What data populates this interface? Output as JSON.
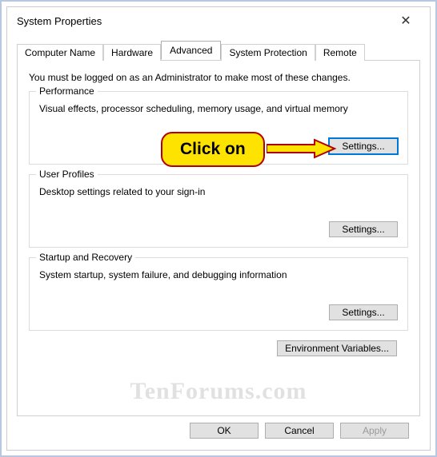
{
  "window": {
    "title": "System Properties"
  },
  "tabs": {
    "computer_name": "Computer Name",
    "hardware": "Hardware",
    "advanced": "Advanced",
    "system_protection": "System Protection",
    "remote": "Remote"
  },
  "advanced": {
    "admin_note": "You must be logged on as an Administrator to make most of these changes.",
    "performance": {
      "title": "Performance",
      "desc": "Visual effects, processor scheduling, memory usage, and virtual memory",
      "settings_btn": "Settings..."
    },
    "user_profiles": {
      "title": "User Profiles",
      "desc": "Desktop settings related to your sign-in",
      "settings_btn": "Settings..."
    },
    "startup_recovery": {
      "title": "Startup and Recovery",
      "desc": "System startup, system failure, and debugging information",
      "settings_btn": "Settings..."
    },
    "env_vars_btn": "Environment Variables..."
  },
  "buttons": {
    "ok": "OK",
    "cancel": "Cancel",
    "apply": "Apply"
  },
  "callout": {
    "text": "Click on"
  },
  "watermark": "TenForums.com"
}
